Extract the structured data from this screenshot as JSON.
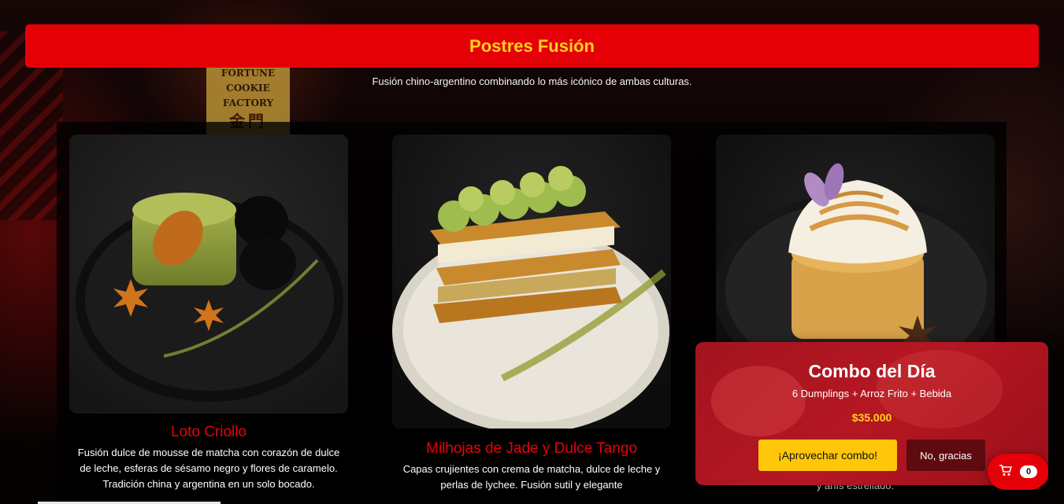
{
  "header": {
    "title": "Postres Fusión",
    "subtitle": "Fusión chino-argentino combinando lo más icónico de ambas culturas."
  },
  "background": {
    "sign_lines": [
      "FORTUNE",
      "COOKIE",
      "FACTORY"
    ],
    "sign_glyphs": "金門"
  },
  "desserts": [
    {
      "name": "Loto Criollo",
      "description": "Fusión dulce de mousse de matcha con corazón de dulce de leche, esferas de sésamo negro y flores de caramelo. Tradición china y argentina en un solo bocado."
    },
    {
      "name": "Milhojas de Jade y Dulce Tango",
      "description": "Capas crujientes con crema de matcha, dulce de leche y perlas de lychee. Fusión sutil y elegante"
    },
    {
      "name": "",
      "description": "y anís estrellado."
    }
  ],
  "combo": {
    "title": "Combo del Día",
    "description": "6 Dumplings + Arroz Frito + Bebida",
    "price": "$35.000",
    "accept_label": "¡Aprovechar combo!",
    "decline_label": "No, gracias"
  },
  "cart": {
    "icon": "shopping-cart-icon",
    "count": "0"
  },
  "colors": {
    "brand_red": "#e50008",
    "accent_yellow": "#ffd11a",
    "popup_red": "#b51722"
  }
}
